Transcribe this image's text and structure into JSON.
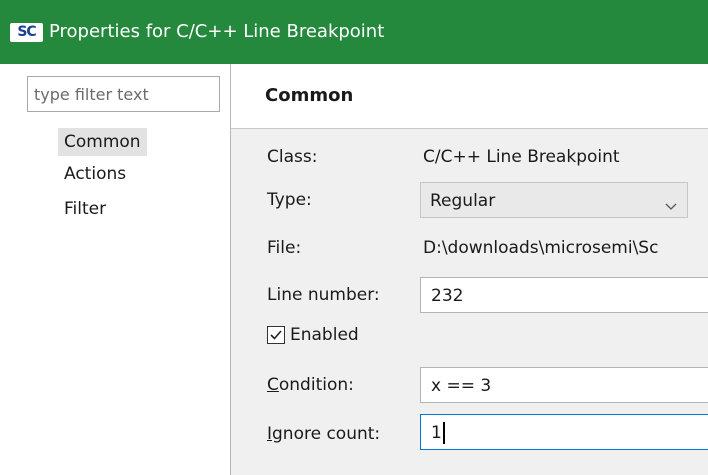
{
  "window": {
    "app_icon_text": "SC",
    "title": "Properties for C/C++ Line Breakpoint",
    "title_bar_color": "#24893c"
  },
  "sidebar": {
    "filter_placeholder": "type filter text",
    "items": [
      {
        "label": "Common",
        "selected": true
      },
      {
        "label": "Actions",
        "selected": false
      },
      {
        "label": "Filter",
        "selected": false
      }
    ]
  },
  "main": {
    "section_title": "Common",
    "class_label": "Class:",
    "class_value": "C/C++ Line Breakpoint",
    "type_label": "Type:",
    "type_value": "Regular",
    "file_label": "File:",
    "file_value": "D:\\downloads\\microsemi\\Sc",
    "line_number_label": "Line number:",
    "line_number_value": "232",
    "enabled_label": "Enabled",
    "enabled_checked": true,
    "condition_label_mnemonic": "C",
    "condition_label_rest": "ondition:",
    "condition_value": "x == 3",
    "ignore_count_label_mnemonic": "I",
    "ignore_count_label_rest": "gnore count:",
    "ignore_count_value": "1"
  },
  "icons": {
    "type_dropdown": "chevron-down-icon",
    "enabled_checkbox": "checkmark-icon"
  },
  "colors": {
    "accent_focus": "#0078d7",
    "selected_item_bg": "#e2e2e2",
    "panel_bg": "#f0f0f0"
  }
}
